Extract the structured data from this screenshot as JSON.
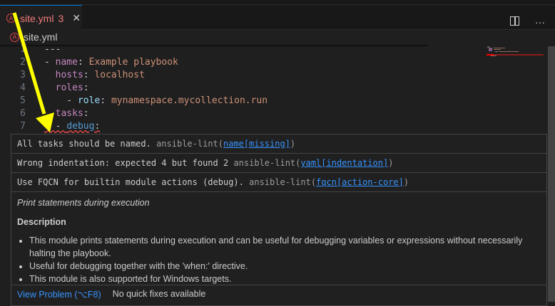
{
  "tab": {
    "icon": "ansible-icon",
    "filename": "site.yml",
    "problem_count": "3",
    "close": "✕"
  },
  "breadcrumb": {
    "filename": "site.yml"
  },
  "code": [
    {
      "n": "1",
      "parts": [
        {
          "c": "",
          "t": "---"
        }
      ]
    },
    {
      "n": "2",
      "parts": [
        {
          "c": "",
          "t": "- "
        },
        {
          "c": "k",
          "t": "name"
        },
        {
          "c": "",
          "t": ": "
        },
        {
          "c": "s",
          "t": "Example playbook"
        }
      ]
    },
    {
      "n": "3",
      "parts": [
        {
          "c": "",
          "t": "  "
        },
        {
          "c": "k",
          "t": "hosts"
        },
        {
          "c": "",
          "t": ": "
        },
        {
          "c": "s",
          "t": "localhost"
        }
      ]
    },
    {
      "n": "4",
      "parts": [
        {
          "c": "",
          "t": "  "
        },
        {
          "c": "k",
          "t": "roles"
        },
        {
          "c": "",
          "t": ":"
        }
      ]
    },
    {
      "n": "5",
      "parts": [
        {
          "c": "",
          "t": "    - "
        },
        {
          "c": "b",
          "t": "role"
        },
        {
          "c": "",
          "t": ": "
        },
        {
          "c": "s",
          "t": "mynamespace.mycollection.run"
        }
      ]
    },
    {
      "n": "6",
      "parts": [
        {
          "c": "",
          "t": "  "
        },
        {
          "c": "k",
          "t": "tasks"
        },
        {
          "c": "",
          "t": ":"
        }
      ]
    },
    {
      "n": "7",
      "parts": [
        {
          "c": "sq",
          "t": "  - "
        },
        {
          "c": "d sq",
          "t": "debug"
        },
        {
          "c": "sq",
          "t": ":"
        }
      ]
    }
  ],
  "hover": {
    "problems": [
      {
        "message": "All tasks should be named.",
        "source": "ansible-lint(",
        "code": "name[missing]",
        "close": ")"
      },
      {
        "message": "Wrong indentation: expected 4 but found 2",
        "source": "ansible-lint(",
        "code": "yaml[indentation]",
        "close": ")"
      },
      {
        "message": "Use FQCN for builtin module actions (debug).",
        "source": "ansible-lint(",
        "code": "fqcn[action-core]",
        "close": ")"
      }
    ],
    "summary": "Print statements during execution",
    "heading": "Description",
    "bullets": [
      "This module prints statements during execution and can be useful for debugging variables or expressions without necessarily halting the playbook.",
      "Useful for debugging together with the 'when:' directive.",
      "This module is also supported for Windows targets."
    ],
    "view_problem": "View Problem (⌥F8)",
    "no_fixes": "No quick fixes available"
  },
  "colors": {
    "accent": "#3794ff",
    "error": "#f14c4c",
    "arrow": "#ffff00"
  }
}
